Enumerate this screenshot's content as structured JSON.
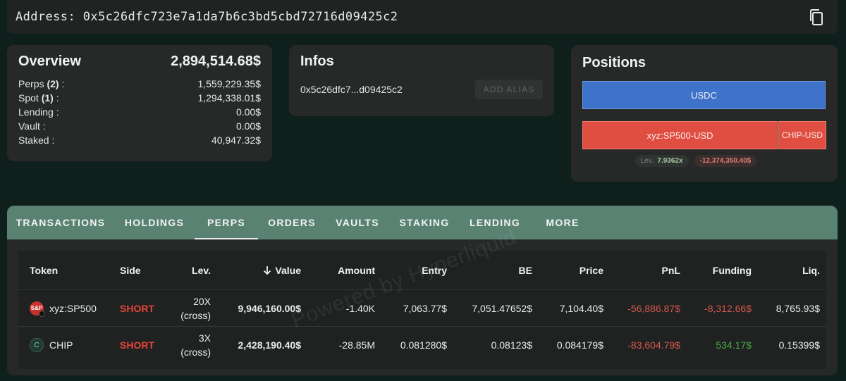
{
  "address": {
    "label": "Address: 0x5c26dfc723e7a1da7b6c3bd5cbd72716d09425c2"
  },
  "overview": {
    "title": "Overview",
    "total": "2,894,514.68$",
    "rows": [
      {
        "label": "Perps ",
        "count": "(2)",
        "suffix": " :",
        "value": "1,559,229.35$"
      },
      {
        "label": "Spot ",
        "count": "(1)",
        "suffix": " :",
        "value": "1,294,338.01$"
      },
      {
        "label": "Lending :",
        "count": "",
        "suffix": "",
        "value": "0.00$"
      },
      {
        "label": "Vault :",
        "count": "",
        "suffix": "",
        "value": "0.00$"
      },
      {
        "label": "Staked :",
        "count": "",
        "suffix": "",
        "value": "40,947.32$"
      }
    ]
  },
  "infos": {
    "title": "Infos",
    "short_address": "0x5c26dfc7...d09425c2",
    "add_alias_label": "ADD ALIAS"
  },
  "positions": {
    "title": "Positions",
    "usdc_label": "USDC",
    "sp500_label": "xyz:SP500-USD",
    "chip_label": "CHIP-USD",
    "lev_label": "Lev.",
    "lev_value": "7.9362x",
    "pnl_value": "-12,374,350.40$"
  },
  "tabs": [
    {
      "label": "TRANSACTIONS"
    },
    {
      "label": "HOLDINGS"
    },
    {
      "label": "PERPS"
    },
    {
      "label": "ORDERS"
    },
    {
      "label": "VAULTS"
    },
    {
      "label": "STAKING"
    },
    {
      "label": "LENDING"
    },
    {
      "label": "MORE"
    }
  ],
  "active_tab": "PERPS",
  "table": {
    "headers": {
      "token": "Token",
      "side": "Side",
      "lev": "Lev.",
      "value": "Value",
      "amount": "Amount",
      "entry": "Entry",
      "be": "BE",
      "price": "Price",
      "pnl": "PnL",
      "funding": "Funding",
      "liq": "Liq."
    },
    "rows": [
      {
        "icon": "S&P",
        "token": "xyz:SP500",
        "side": "SHORT",
        "lev": "20X",
        "lev_mode": "(cross)",
        "value": "9,946,160.00$",
        "amount": "-1.40K",
        "entry": "7,063.77$",
        "be": "7,051.47652$",
        "price": "7,104.40$",
        "pnl": "-56,886.87$",
        "funding": "-8,312.66$",
        "liq": "8,765.93$"
      },
      {
        "icon": "C",
        "token": "CHIP",
        "side": "SHORT",
        "lev": "3X",
        "lev_mode": "(cross)",
        "value": "2,428,190.40$",
        "amount": "-28.85M",
        "entry": "0.081280$",
        "be": "0.08123$",
        "price": "0.084179$",
        "pnl": "-83,604.79$",
        "funding": "534.17$",
        "liq": "0.15399$"
      }
    ]
  },
  "watermark": "Powered by Hyperliquid"
}
